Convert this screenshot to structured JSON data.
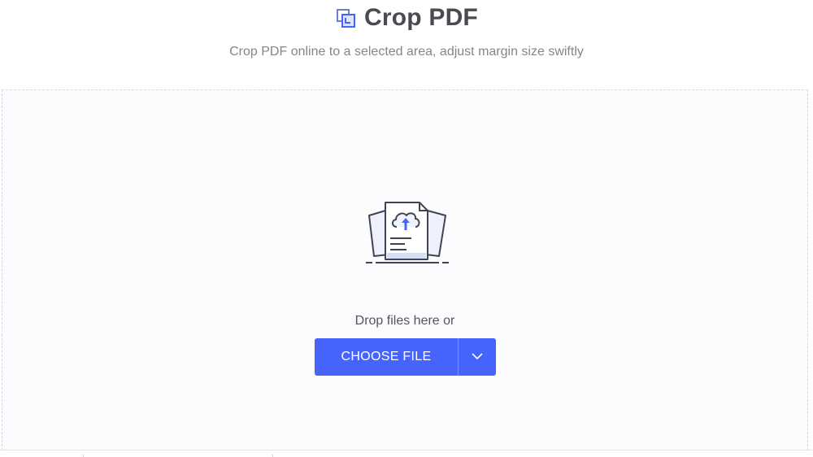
{
  "header": {
    "title": "Crop PDF",
    "title_icon": "crop-icon",
    "subtitle": "Crop PDF online to a selected area, adjust margin size swiftly"
  },
  "dropzone": {
    "illustration_icon": "cloud-upload-document-icon",
    "drop_text": "Drop files here or",
    "choose_label": "CHOOSE FILE",
    "dropdown_icon": "chevron-down-icon"
  },
  "colors": {
    "accent": "#4664fc",
    "title": "#4a4a50",
    "subtitle": "#858590",
    "dropzone_bg": "#fcfbfd",
    "dropzone_border": "#dcd3e3"
  }
}
